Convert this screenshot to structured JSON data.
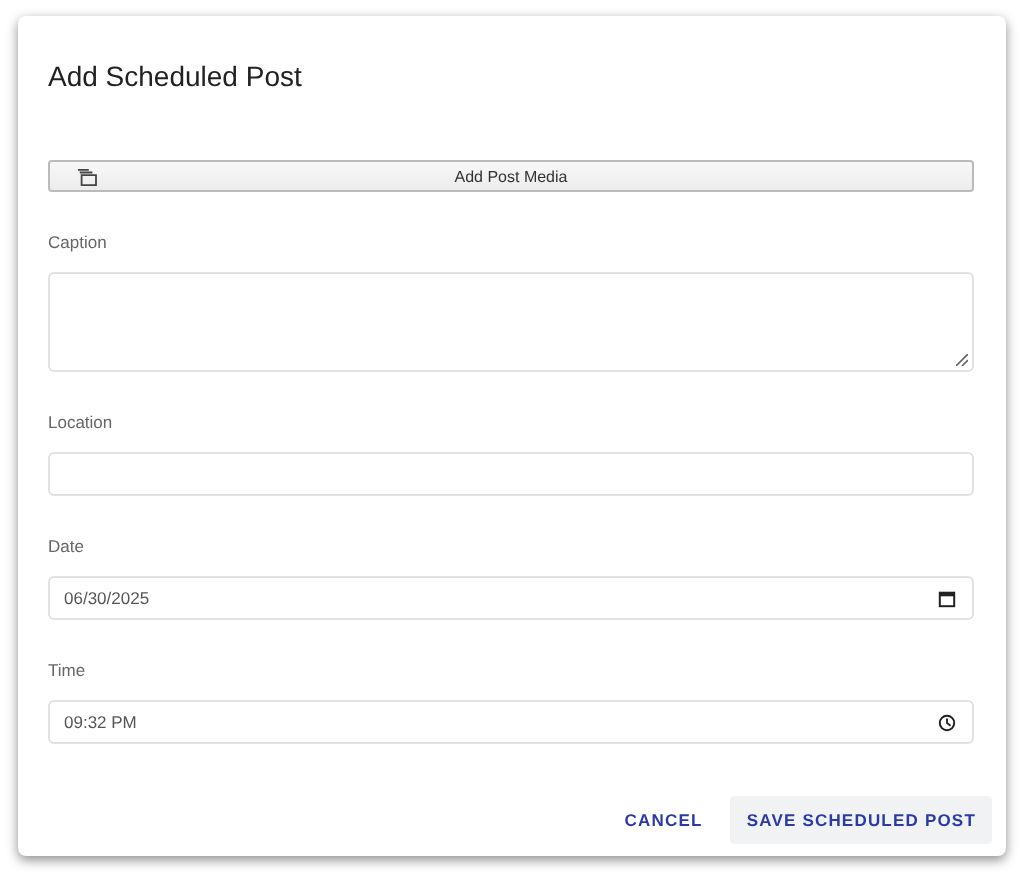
{
  "dialog": {
    "title": "Add Scheduled Post"
  },
  "media_button": {
    "label": "Add Post Media"
  },
  "fields": [
    {
      "label": "Caption",
      "kind": "textarea"
    },
    {
      "label": "Location",
      "kind": "text"
    },
    {
      "label": "Date",
      "kind": "date",
      "value": "06/30/2025"
    },
    {
      "label": "Time",
      "kind": "time",
      "value": "09:32 PM"
    }
  ],
  "buttons": [
    {
      "label": "CANCEL",
      "kind": "text"
    },
    {
      "label": "SAVE SCHEDULED POST",
      "kind": "tonal"
    }
  ]
}
